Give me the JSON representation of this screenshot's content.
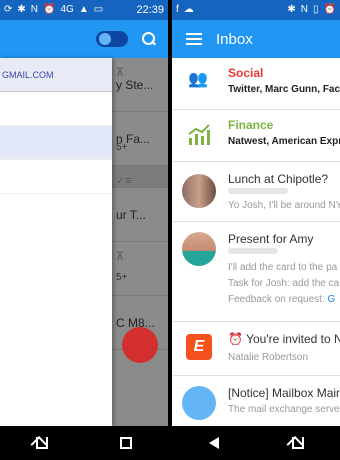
{
  "left_screen": {
    "status_bar": {
      "time": "22:39",
      "network": "4G"
    },
    "drawer": {
      "account_email": "GMAIL.COM",
      "items": [
        "",
        "",
        "",
        ""
      ]
    },
    "behind_list": [
      {
        "text": "y Ste...",
        "count": ""
      },
      {
        "text": "n Fa...",
        "count": "5+"
      },
      {
        "text": "",
        "count": ""
      },
      {
        "text": "ur T...",
        "count": ""
      },
      {
        "text": "",
        "count": "5+"
      },
      {
        "text": "C M8...",
        "count": ""
      }
    ]
  },
  "right_screen": {
    "status_bar": {
      "time": ""
    },
    "app_bar": {
      "title": "Inbox"
    },
    "items": [
      {
        "title": "Social",
        "subtitle": "Twitter, Marc Gunn, Face",
        "title_color": "#e53935",
        "icon": "social-people-icon"
      },
      {
        "title": "Finance",
        "subtitle": "Natwest, American Expre",
        "title_color": "#7cb342",
        "icon": "finance-chart-icon"
      },
      {
        "title": "Lunch at Chipotle?",
        "subtitle": "Yo Josh, I'll be around NY"
      },
      {
        "title": "Present for Amy",
        "line1": "I'll add the card to the pa",
        "line2": "Task for Josh: add the ca",
        "line3": "Feedback on request:",
        "line3_link": "G"
      },
      {
        "title": "You're invited to Na",
        "subtitle": "Natalie Robertson",
        "badge": "E"
      },
      {
        "title": "[Notice] Mailbox Main",
        "subtitle": "The mail exchange server"
      }
    ]
  }
}
